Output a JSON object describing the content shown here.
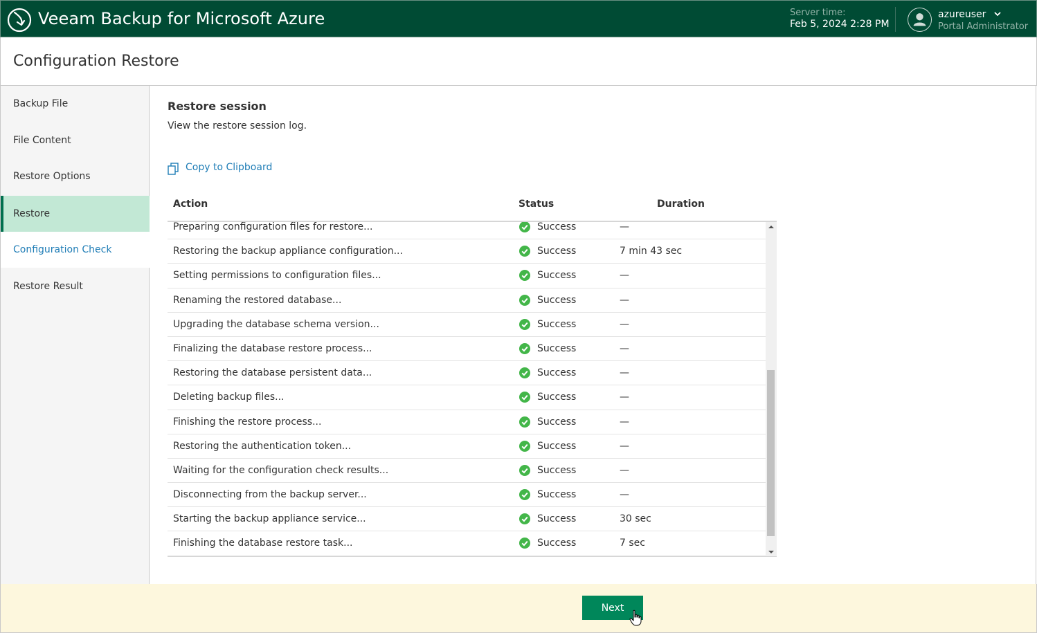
{
  "header": {
    "app_title": "Veeam Backup for Microsoft Azure",
    "server_time_label": "Server time:",
    "server_time_value": "Feb 5, 2024 2:28 PM",
    "user_name": "azureuser",
    "user_role": "Portal Administrator",
    "colors": {
      "background": "#004b34",
      "muted_text": "#93b3a8"
    }
  },
  "page_title": "Configuration Restore",
  "wizard_steps": [
    {
      "label": "Backup File",
      "state": "completed"
    },
    {
      "label": "File Content",
      "state": "completed"
    },
    {
      "label": "Restore Options",
      "state": "completed"
    },
    {
      "label": "Restore",
      "state": "active"
    },
    {
      "label": "Configuration Check",
      "state": "link"
    },
    {
      "label": "Restore Result",
      "state": "pending"
    }
  ],
  "main": {
    "section_title": "Restore session",
    "section_desc": "View the restore session log.",
    "copy_label": "Copy to Clipboard",
    "table": {
      "headers": {
        "action": "Action",
        "status": "Status",
        "duration": "Duration"
      },
      "rows": [
        {
          "action": "Preparing configuration files for restore...",
          "status": "Success",
          "duration": "—"
        },
        {
          "action": "Restoring the backup appliance configuration...",
          "status": "Success",
          "duration": "7 min 43 sec"
        },
        {
          "action": "Setting permissions to configuration files...",
          "status": "Success",
          "duration": "—"
        },
        {
          "action": "Renaming the restored database...",
          "status": "Success",
          "duration": "—"
        },
        {
          "action": "Upgrading the database schema version...",
          "status": "Success",
          "duration": "—"
        },
        {
          "action": "Finalizing the database restore process...",
          "status": "Success",
          "duration": "—"
        },
        {
          "action": "Restoring the database persistent data...",
          "status": "Success",
          "duration": "—"
        },
        {
          "action": "Deleting backup files...",
          "status": "Success",
          "duration": "—"
        },
        {
          "action": "Finishing the restore process...",
          "status": "Success",
          "duration": "—"
        },
        {
          "action": "Restoring the authentication token...",
          "status": "Success",
          "duration": "—"
        },
        {
          "action": "Waiting for the configuration check results...",
          "status": "Success",
          "duration": "—"
        },
        {
          "action": "Disconnecting from the backup server...",
          "status": "Success",
          "duration": "—"
        },
        {
          "action": "Starting the backup appliance service...",
          "status": "Success",
          "duration": "30 sec"
        },
        {
          "action": "Finishing the database restore task...",
          "status": "Success",
          "duration": "7 sec"
        }
      ]
    }
  },
  "footer": {
    "next_label": "Next"
  },
  "colors": {
    "accent": "#00875a",
    "success": "#43b649",
    "link": "#1f7db6",
    "footer_bg": "#fdf7dd"
  },
  "icons": {
    "logo": "veeam-logo-icon",
    "user": "user-avatar-icon",
    "copy": "copy-icon",
    "success": "success-check-icon"
  }
}
